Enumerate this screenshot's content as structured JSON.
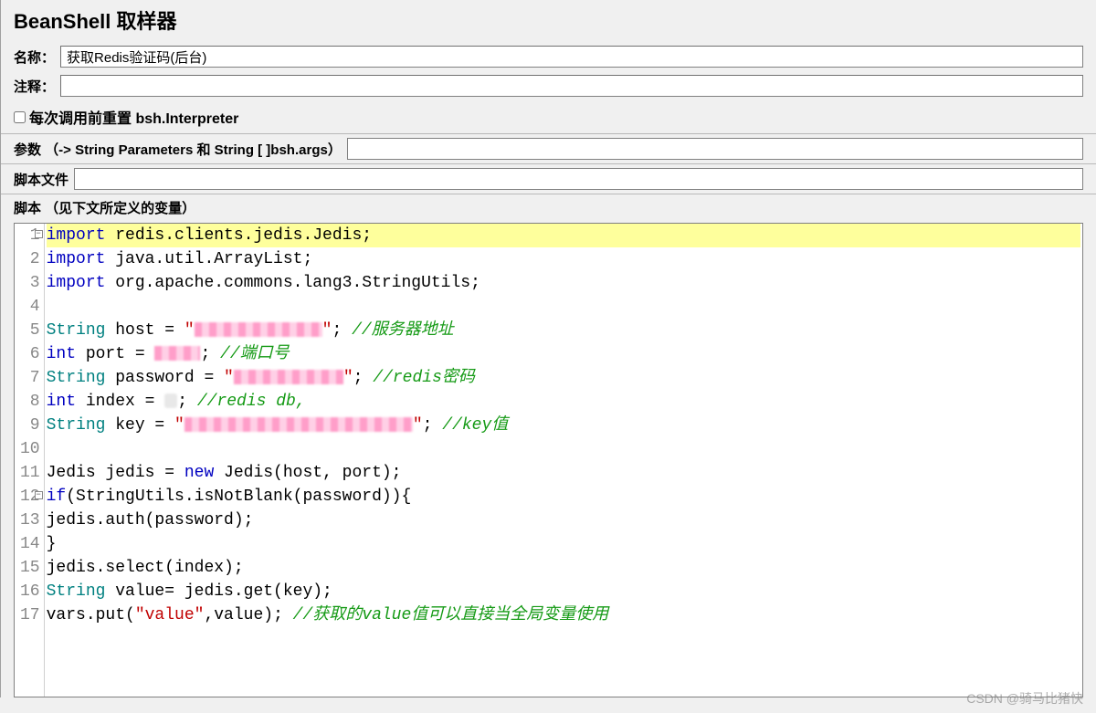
{
  "header": {
    "title": "BeanShell 取样器"
  },
  "fields": {
    "name_label": "名称：",
    "name_value": "获取Redis验证码(后台)",
    "comment_label": "注释：",
    "comment_value": "",
    "reset_label": "每次调用前重置 bsh.Interpreter",
    "params_label": "参数 （-> String Parameters 和 String [ ]bsh.args）",
    "params_value": "",
    "file_label": "脚本文件",
    "file_value": "",
    "script_label": "脚本 （见下文所定义的变量）"
  },
  "code": {
    "lines": [
      {
        "n": 1,
        "fold": true,
        "hl": true,
        "tokens": [
          [
            "k",
            "import"
          ],
          [
            "n",
            " redis.clients.jedis.Jedis;"
          ]
        ]
      },
      {
        "n": 2,
        "tokens": [
          [
            "k",
            "import"
          ],
          [
            "n",
            " java.util.ArrayList;"
          ]
        ]
      },
      {
        "n": 3,
        "tokens": [
          [
            "k",
            "import"
          ],
          [
            "n",
            " org.apache.commons.lang3.StringUtils;"
          ]
        ]
      },
      {
        "n": 4,
        "tokens": []
      },
      {
        "n": 5,
        "tokens": [
          [
            "t",
            "String"
          ],
          [
            "n",
            " host = "
          ],
          [
            "s",
            "\""
          ],
          [
            "redact",
            "1"
          ],
          [
            "s",
            "\""
          ],
          [
            "n",
            "; "
          ],
          [
            "c",
            "//服务器地址"
          ]
        ]
      },
      {
        "n": 6,
        "tokens": [
          [
            "k",
            "int"
          ],
          [
            "n",
            " port = "
          ],
          [
            "redact",
            "2"
          ],
          [
            "n",
            "; "
          ],
          [
            "c",
            "//端口号"
          ]
        ]
      },
      {
        "n": 7,
        "tokens": [
          [
            "t",
            "String"
          ],
          [
            "n",
            " password = "
          ],
          [
            "s",
            "\""
          ],
          [
            "redact",
            "3"
          ],
          [
            "s",
            "\""
          ],
          [
            "n",
            "; "
          ],
          [
            "c",
            "//redis密码"
          ]
        ]
      },
      {
        "n": 8,
        "tokens": [
          [
            "k",
            "int"
          ],
          [
            "n",
            " index = "
          ],
          [
            "redact",
            "4"
          ],
          [
            "n",
            "; "
          ],
          [
            "c",
            "//redis db,"
          ]
        ]
      },
      {
        "n": 9,
        "tokens": [
          [
            "t",
            "String"
          ],
          [
            "n",
            " key = "
          ],
          [
            "s",
            "\""
          ],
          [
            "redact",
            "5"
          ],
          [
            "s",
            "\""
          ],
          [
            "n",
            "; "
          ],
          [
            "c",
            "//key值"
          ]
        ]
      },
      {
        "n": 10,
        "tokens": []
      },
      {
        "n": 11,
        "tokens": [
          [
            "n",
            "Jedis jedis = "
          ],
          [
            "k",
            "new"
          ],
          [
            "n",
            " Jedis(host, port);"
          ]
        ]
      },
      {
        "n": 12,
        "fold": true,
        "tokens": [
          [
            "k",
            "if"
          ],
          [
            "n",
            "(StringUtils.isNotBlank(password)){"
          ]
        ]
      },
      {
        "n": 13,
        "tokens": [
          [
            "n",
            "jedis.auth(password);"
          ]
        ]
      },
      {
        "n": 14,
        "tokens": [
          [
            "n",
            "}"
          ]
        ]
      },
      {
        "n": 15,
        "tokens": [
          [
            "n",
            "jedis.select(index);"
          ]
        ]
      },
      {
        "n": 16,
        "tokens": [
          [
            "t",
            "String"
          ],
          [
            "n",
            " value= jedis.get(key);"
          ]
        ]
      },
      {
        "n": 17,
        "tokens": [
          [
            "n",
            "vars.put("
          ],
          [
            "s",
            "\"value\""
          ],
          [
            "n",
            ",value); "
          ],
          [
            "c",
            "//获取的value值可以直接当全局变量使用"
          ]
        ]
      }
    ]
  },
  "watermark": "CSDN @骑马比猪快"
}
